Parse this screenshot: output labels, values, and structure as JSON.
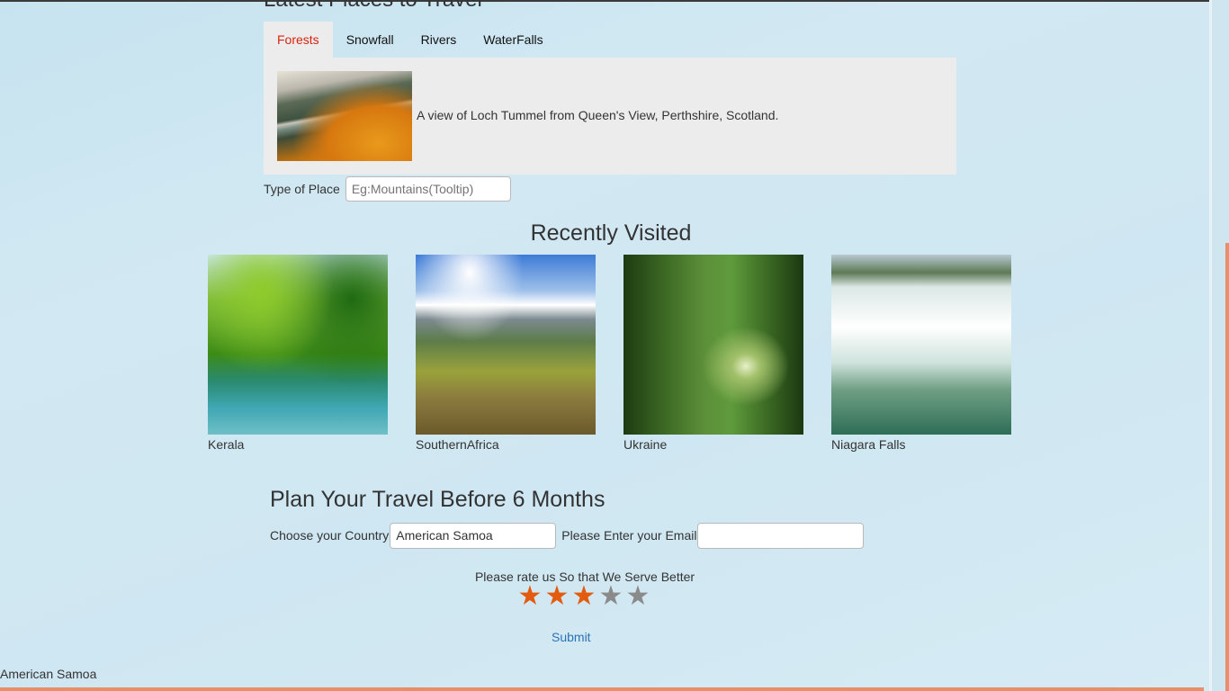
{
  "colors": {
    "accent_orange": "#e35b0f",
    "active_tab_red": "#d9230f",
    "link_blue": "#2a72b5",
    "star_off": "#8a8a8a"
  },
  "latest": {
    "heading": "Latest Places to Travel",
    "tabs": [
      {
        "label": "Forests",
        "active": true
      },
      {
        "label": "Snowfall",
        "active": false
      },
      {
        "label": "Rivers",
        "active": false
      },
      {
        "label": "WaterFalls",
        "active": false
      }
    ],
    "panel_caption": "A view of Loch Tummel from Queen's View, Perthshire, Scotland."
  },
  "place_type": {
    "label": "Type of Place",
    "placeholder": "Eg:Mountains(Tooltip)"
  },
  "recent": {
    "heading": "Recently Visited",
    "items": [
      {
        "caption": "Kerala"
      },
      {
        "caption": "SouthernAfrica"
      },
      {
        "caption": "Ukraine"
      },
      {
        "caption": "Niagara Falls"
      }
    ]
  },
  "plan": {
    "heading": "Plan Your Travel Before 6 Months",
    "country_label": "Choose your Country",
    "country_value": "American Samoa",
    "email_label": "Please Enter your Email",
    "email_value": ""
  },
  "rating": {
    "prompt": "Please rate us So that We Serve Better",
    "value": 3,
    "max": 5,
    "star_glyph": "★"
  },
  "submit_label": "Submit",
  "footer_text": "American Samoa"
}
